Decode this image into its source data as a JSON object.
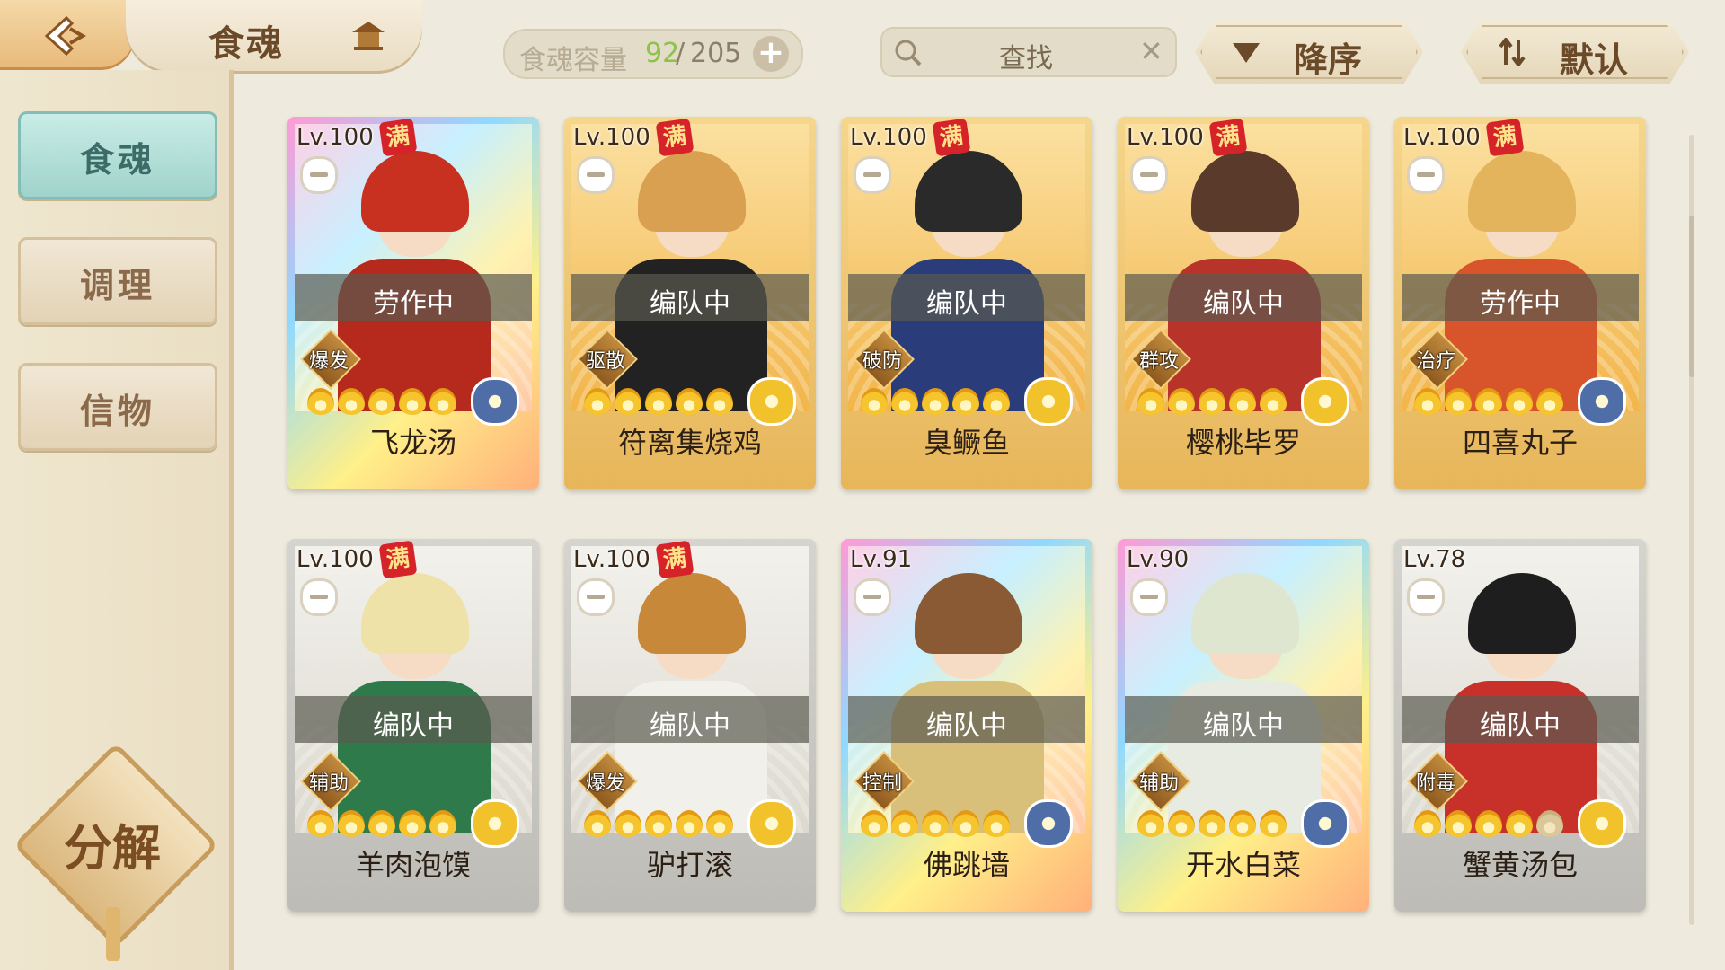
{
  "header": {
    "title": "食魂",
    "capacity_label": "食魂容量",
    "capacity_current": "92",
    "capacity_sep": "/",
    "capacity_max": "205",
    "capacity_add": "+",
    "search_text": "查找",
    "search_clear": "✕",
    "sort_order_label": "降序",
    "sort_mode_label": "默认"
  },
  "sidebar": {
    "items": [
      {
        "label": "食魂",
        "active": true
      },
      {
        "label": "调理",
        "active": false
      },
      {
        "label": "信物",
        "active": false
      }
    ],
    "decompose_label": "分解"
  },
  "cards": [
    {
      "level": "Lv.100",
      "full": "满",
      "status": "劳作中",
      "role": "爆发",
      "name": "飞龙汤",
      "stars": 5,
      "rarity_color": "#4f6ea8",
      "hair": "#c8311f",
      "body": "#b52a1c",
      "bg": "rainbow"
    },
    {
      "level": "Lv.100",
      "full": "满",
      "status": "编队中",
      "role": "驱散",
      "name": "符离集烧鸡",
      "stars": 5,
      "rarity_color": "#f2c22c",
      "hair": "#d8a050",
      "body": "#222222",
      "bg": "gold"
    },
    {
      "level": "Lv.100",
      "full": "满",
      "status": "编队中",
      "role": "破防",
      "name": "臭鳜鱼",
      "stars": 5,
      "rarity_color": "#f2c22c",
      "hair": "#2a2a2a",
      "body": "#2b3c7a",
      "bg": "gold"
    },
    {
      "level": "Lv.100",
      "full": "满",
      "status": "编队中",
      "role": "群攻",
      "name": "樱桃毕罗",
      "stars": 5,
      "rarity_color": "#f2c22c",
      "hair": "#5a3a2a",
      "body": "#b8342a",
      "bg": "gold"
    },
    {
      "level": "Lv.100",
      "full": "满",
      "status": "劳作中",
      "role": "治疗",
      "name": "四喜丸子",
      "stars": 5,
      "rarity_color": "#4f6ea8",
      "hair": "#e3b45c",
      "body": "#d8542a",
      "bg": "gold"
    },
    {
      "level": "Lv.100",
      "full": "满",
      "status": "编队中",
      "role": "辅助",
      "name": "羊肉泡馍",
      "stars": 5,
      "rarity_color": "#f2c22c",
      "hair": "#efe2a8",
      "body": "#2f7a4a",
      "bg": "white"
    },
    {
      "level": "Lv.100",
      "full": "满",
      "status": "编队中",
      "role": "爆发",
      "name": "驴打滚",
      "stars": 5,
      "rarity_color": "#f2c22c",
      "hair": "#c8883a",
      "body": "#f2f0ea",
      "bg": "white"
    },
    {
      "level": "Lv.91",
      "full": "",
      "status": "编队中",
      "role": "控制",
      "name": "佛跳墙",
      "stars": 5,
      "rarity_color": "#4f6ea8",
      "hair": "#8a5a34",
      "body": "#d9c07a",
      "bg": "rainbow"
    },
    {
      "level": "Lv.90",
      "full": "",
      "status": "编队中",
      "role": "辅助",
      "name": "开水白菜",
      "stars": 5,
      "rarity_color": "#4f6ea8",
      "hair": "#dfe6d0",
      "body": "#e8ebe2",
      "bg": "rainbow"
    },
    {
      "level": "Lv.78",
      "full": "",
      "status": "编队中",
      "role": "附毒",
      "name": "蟹黄汤包",
      "stars": 4,
      "rarity_color": "#f2c22c",
      "hair": "#1e1e1e",
      "body": "#c8302a",
      "bg": "white"
    }
  ]
}
